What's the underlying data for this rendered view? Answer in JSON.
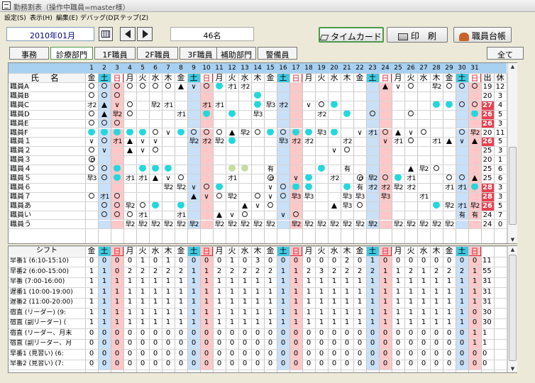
{
  "window": {
    "title": "勤務割表（操作中職員=master様）"
  },
  "menu": [
    "設定(S)",
    "表示(H)",
    "編集(E)",
    "デバッグ(D)",
    "ステップ(Z)"
  ],
  "toolbar": {
    "month": "2010年01月",
    "staff_count": "46名",
    "timecard_label": "タイムカード",
    "print_label": "印　刷",
    "staff_ledger_label": "職員台帳"
  },
  "departments": [
    "事務",
    "診療部門",
    "1F職員",
    "2F職員",
    "3F職員",
    "補助部門",
    "警備員"
  ],
  "selected_department": "診療部門",
  "all_label": "全て",
  "grid": {
    "name_header": "氏 名",
    "days": [
      "1",
      "2",
      "3",
      "4",
      "5",
      "6",
      "7",
      "8",
      "9",
      "10",
      "11",
      "12",
      "13",
      "14",
      "15",
      "16",
      "17",
      "18",
      "19",
      "20",
      "21",
      "22",
      "23",
      "24",
      "25",
      "26",
      "27",
      "28",
      "29",
      "30",
      "31"
    ],
    "weekdays": [
      "金",
      "土",
      "日",
      "月",
      "火",
      "水",
      "木",
      "金",
      "土",
      "日",
      "月",
      "火",
      "水",
      "木",
      "金",
      "土",
      "日",
      "月",
      "火",
      "水",
      "木",
      "金",
      "土",
      "日",
      "月",
      "火",
      "水",
      "木",
      "金",
      "土",
      "日"
    ],
    "total_headers": [
      "出",
      "休"
    ],
    "rows": [
      {
        "name": "職員A",
        "cells": [
          "o",
          "o",
          "o",
          "o",
          "o",
          "o",
          "o",
          "t",
          "v",
          "o",
          "C",
          "オ1",
          "オ2",
          "",
          "",
          "",
          "",
          "",
          "",
          "",
          "",
          "",
          "",
          "t",
          "v",
          "o",
          "",
          "早2",
          "o",
          "o",
          "o"
        ],
        "work": "19",
        "off": "12"
      },
      {
        "name": "職員B",
        "cells": [
          "o",
          "o",
          "o",
          "",
          "",
          "",
          "",
          "",
          "",
          "",
          "",
          "",
          "",
          "C",
          "",
          "",
          "",
          "",
          "",
          "",
          "",
          "",
          "",
          "",
          "",
          "",
          "",
          "",
          "",
          "",
          ""
        ],
        "work": "20",
        "off": "3"
      },
      {
        "name": "職員C",
        "cells": [
          "オ2",
          "t",
          "v",
          "o",
          "",
          "早2",
          "オ1",
          "",
          "",
          "オ1",
          "オ1",
          "",
          "",
          "C",
          "早3",
          "オ2",
          "",
          "v",
          "o",
          "C",
          "",
          "",
          "",
          "",
          "",
          "",
          "",
          "C",
          "C",
          "o",
          "o"
        ],
        "work": "27",
        "off": "4"
      },
      {
        "name": "職員D",
        "cells": [
          "o",
          "t",
          "早2",
          "o",
          "",
          "",
          "",
          "オ1",
          "",
          "C",
          "",
          "C",
          "",
          "早3",
          "",
          "",
          "",
          "",
          "オ2",
          "",
          "C",
          "",
          "o",
          "",
          "",
          "o",
          "",
          "",
          "",
          "",
          "C"
        ],
        "work": "26",
        "off": "5"
      },
      {
        "name": "職員E",
        "cells": [
          "o",
          "o",
          "o",
          "",
          "",
          "",
          "",
          "",
          "",
          "",
          "",
          "",
          "",
          "",
          "",
          "",
          "",
          "",
          "",
          "",
          "",
          "",
          "",
          "",
          "",
          "",
          "",
          "",
          "",
          "",
          ""
        ],
        "work": "26",
        "off": "3"
      },
      {
        "name": "職員F",
        "cells": [
          "C",
          "C",
          "C",
          "C",
          "C",
          "o",
          "v",
          "C",
          "o",
          "o",
          "o",
          "t",
          "早2",
          "o",
          "C",
          "o",
          "C",
          "C",
          "早3",
          "C",
          "",
          "v",
          "オ1",
          "o",
          "t",
          "v",
          "o",
          "",
          "",
          "o",
          "早2"
        ],
        "work": "20",
        "off": "11"
      },
      {
        "name": "職員１",
        "cells": [
          "v",
          "o",
          "オ1",
          "t",
          "v",
          "v",
          "",
          "",
          "早2",
          "オ2",
          "早2",
          "C",
          "",
          "",
          "",
          "早3",
          "オ2",
          "オ2",
          "",
          "",
          "オ2",
          "",
          "",
          "v",
          "オ1",
          "o",
          "",
          "オ1",
          "t",
          "v",
          "t"
        ],
        "work": "26",
        "off": "5"
      },
      {
        "name": "職員２",
        "cells": [
          "o",
          "v",
          "",
          "t",
          "v",
          "o",
          "",
          "",
          "",
          "",
          "",
          "",
          "",
          "",
          "",
          "",
          "",
          "",
          "",
          "v",
          "o",
          "",
          "",
          "",
          "",
          "",
          "",
          "",
          "",
          "",
          ""
        ],
        "work": "25",
        "off": "3"
      },
      {
        "name": "職員３",
        "cells": [
          "w",
          "",
          "",
          "",
          "",
          "",
          "",
          "",
          "",
          "",
          "",
          "",
          "",
          "",
          "",
          "",
          "",
          "",
          "",
          "",
          "",
          "",
          "",
          "",
          "",
          "",
          "",
          "",
          "",
          "",
          ""
        ],
        "work": "20",
        "off": "1"
      },
      {
        "name": "職員４",
        "cells": [
          "o",
          "o",
          "C",
          "",
          "C",
          "C",
          "C",
          "",
          "",
          "",
          "",
          "L",
          "L",
          "",
          "有",
          "",
          "",
          "",
          "C",
          "",
          "有",
          "",
          "",
          "",
          "",
          "t",
          "早2",
          "o",
          "",
          "",
          ""
        ],
        "work": "25",
        "off": "6"
      },
      {
        "name": "職員５",
        "cells": [
          "早3",
          "o",
          "C",
          "オ1",
          "オ1",
          "t",
          "v",
          "o",
          "",
          "",
          "",
          "オ1",
          "",
          "",
          "w",
          "",
          "v",
          "C",
          "",
          "オ2",
          "",
          "w",
          "早2",
          "o",
          "C",
          "オ1",
          "",
          "",
          "o",
          "o",
          "t"
        ],
        "work": "25",
        "off": "6"
      },
      {
        "name": "職員６",
        "cells": [
          "",
          "",
          "",
          "",
          "",
          "",
          "早2",
          "早2",
          "v",
          "o",
          "C",
          "",
          "",
          "",
          "v",
          "o",
          "C",
          "C",
          "",
          "",
          "C",
          "有",
          "オ2",
          "オ2",
          "早2",
          "オ2",
          "",
          "",
          "オ1",
          "オ1",
          "C"
        ],
        "work": "28",
        "off": "3"
      },
      {
        "name": "職員７",
        "cells": [
          "o",
          "オ1",
          "o",
          "",
          "",
          "",
          "",
          "",
          "t",
          "v",
          "o",
          "早2",
          "",
          "o",
          "v",
          "o",
          "早3",
          "早3",
          "",
          "",
          "早3",
          "早3",
          "",
          "早3",
          "",
          "",
          "オ1",
          "",
          "",
          "",
          ""
        ],
        "work": "28",
        "off": "3"
      },
      {
        "name": "職員あ",
        "cells": [
          "",
          "o",
          "o",
          "早2",
          "o",
          "C",
          "",
          "C",
          "",
          "",
          "",
          "",
          "t",
          "v",
          "o",
          "",
          "",
          "",
          "",
          "t",
          "早3",
          "o",
          "",
          "",
          "",
          "",
          "",
          "C",
          "早2",
          "オ1",
          "早2"
        ],
        "work": "26",
        "off": "5"
      },
      {
        "name": "職員い",
        "cells": [
          "",
          "o",
          "o",
          "o",
          "オ1",
          "",
          "",
          "オ1",
          "",
          "",
          "t",
          "v",
          "o",
          "",
          "",
          "v",
          "o",
          "",
          "",
          "",
          "",
          "",
          "",
          "",
          "",
          "",
          "",
          "",
          "",
          "有",
          "有"
        ],
        "work": "24",
        "off": "7"
      },
      {
        "name": "職員う",
        "cells": [
          "",
          "",
          "",
          "早2",
          "早2",
          "早2",
          "早2",
          "早2",
          "早2",
          "",
          "早2",
          "早2",
          "早2",
          "早2",
          "早2",
          "",
          "早2",
          "早2",
          "早2",
          "早2",
          "早2",
          "早2",
          "早2",
          "",
          "早2",
          "早2",
          "早2",
          "早2",
          "早2",
          "",
          ""
        ],
        "work": "24",
        "off": "0"
      }
    ]
  },
  "shift_table": {
    "header": "シフト",
    "rows": [
      {
        "name": "早番1 (6:10-15:10)",
        "values": [
          "0",
          "0",
          "0",
          "0",
          "1",
          "0",
          "1",
          "0",
          "0",
          "0",
          "0",
          "1",
          "0",
          "3",
          "0",
          "0",
          "0",
          "0",
          "0",
          "0",
          "2",
          "0",
          "1",
          "0",
          "0",
          "0",
          "0",
          "0",
          "0",
          "0",
          "0"
        ],
        "total": "11"
      },
      {
        "name": "早番2 (6:00-15:00)",
        "values": [
          "1",
          "1",
          "0",
          "2",
          "2",
          "2",
          "2",
          "2",
          "1",
          "1",
          "2",
          "2",
          "2",
          "2",
          "2",
          "1",
          "1",
          "2",
          "3",
          "2",
          "2",
          "2",
          "2",
          "1",
          "1",
          "2",
          "1",
          "2",
          "2",
          "2",
          "1"
        ],
        "total": "55"
      },
      {
        "name": "早番 (7:00-16:00)",
        "values": [
          "1",
          "1",
          "1",
          "1",
          "1",
          "1",
          "1",
          "1",
          "1",
          "1",
          "1",
          "1",
          "1",
          "1",
          "1",
          "1",
          "1",
          "1",
          "1",
          "1",
          "1",
          "1",
          "1",
          "1",
          "1",
          "1",
          "1",
          "1",
          "1",
          "1",
          "1"
        ],
        "total": "31"
      },
      {
        "name": "遅番1 (10:00-19:00)",
        "values": [
          "1",
          "1",
          "1",
          "1",
          "1",
          "1",
          "1",
          "1",
          "1",
          "1",
          "1",
          "1",
          "1",
          "1",
          "1",
          "1",
          "1",
          "1",
          "1",
          "1",
          "1",
          "1",
          "1",
          "1",
          "1",
          "1",
          "1",
          "1",
          "1",
          "1",
          "1"
        ],
        "total": "31"
      },
      {
        "name": "遅番2 (11:00-20:00)",
        "values": [
          "1",
          "1",
          "1",
          "1",
          "1",
          "1",
          "1",
          "1",
          "1",
          "1",
          "1",
          "1",
          "1",
          "1",
          "1",
          "1",
          "1",
          "1",
          "1",
          "1",
          "1",
          "1",
          "1",
          "1",
          "1",
          "1",
          "1",
          "1",
          "1",
          "1",
          "1"
        ],
        "total": "31"
      },
      {
        "name": "宿直 (リーダー) (9:",
        "values": [
          "1",
          "1",
          "1",
          "1",
          "1",
          "1",
          "1",
          "1",
          "1",
          "1",
          "1",
          "1",
          "1",
          "1",
          "1",
          "1",
          "1",
          "1",
          "1",
          "1",
          "1",
          "1",
          "1",
          "1",
          "1",
          "1",
          "1",
          "1",
          "1",
          "1",
          "0"
        ],
        "total": "30"
      },
      {
        "name": "宿直 (副リーダー) (",
        "values": [
          "1",
          "1",
          "1",
          "1",
          "1",
          "1",
          "1",
          "1",
          "1",
          "1",
          "1",
          "1",
          "1",
          "1",
          "1",
          "1",
          "1",
          "1",
          "1",
          "1",
          "1",
          "1",
          "1",
          "1",
          "1",
          "1",
          "1",
          "1",
          "1",
          "1",
          "0"
        ],
        "total": "30"
      },
      {
        "name": "宿直 (リーダー、月末",
        "values": [
          "0",
          "0",
          "0",
          "0",
          "0",
          "0",
          "0",
          "0",
          "0",
          "0",
          "0",
          "0",
          "0",
          "0",
          "0",
          "0",
          "0",
          "0",
          "0",
          "0",
          "0",
          "0",
          "0",
          "0",
          "0",
          "0",
          "0",
          "0",
          "0",
          "0",
          "1"
        ],
        "total": "1"
      },
      {
        "name": "宿直 (副リーダー、月",
        "values": [
          "0",
          "0",
          "0",
          "0",
          "0",
          "0",
          "0",
          "0",
          "0",
          "0",
          "0",
          "0",
          "0",
          "0",
          "0",
          "0",
          "0",
          "0",
          "0",
          "0",
          "0",
          "0",
          "0",
          "0",
          "0",
          "0",
          "0",
          "0",
          "0",
          "0",
          "1"
        ],
        "total": "1"
      },
      {
        "name": "早番1 (見習い) (6:",
        "values": [
          "0",
          "0",
          "0",
          "0",
          "0",
          "0",
          "0",
          "0",
          "0",
          "0",
          "0",
          "0",
          "0",
          "0",
          "0",
          "0",
          "0",
          "0",
          "0",
          "0",
          "0",
          "0",
          "0",
          "0",
          "0",
          "0",
          "0",
          "0",
          "0",
          "0",
          "0"
        ],
        "total": "0"
      },
      {
        "name": "早番2 (見習い) (7:",
        "values": [
          "0",
          "0",
          "0",
          "0",
          "0",
          "0",
          "0",
          "0",
          "0",
          "0",
          "0",
          "0",
          "0",
          "0",
          "0",
          "0",
          "0",
          "0",
          "0",
          "0",
          "0",
          "0",
          "0",
          "0",
          "0",
          "0",
          "0",
          "0",
          "0",
          "0",
          "0"
        ],
        "total": "0"
      }
    ]
  },
  "colors": {
    "cyan": "#22d8dc",
    "light_green": "#c8dca0",
    "sat_bg": "#c8e0f8",
    "sun_bg": "#ffc8c8",
    "header_blue": "#a8d0f0",
    "warn_red": "#e84050"
  },
  "icons": {
    "calendar": "calendar-icon",
    "prev": "chevron-left-icon",
    "next": "chevron-right-icon",
    "timecard": "timecard-icon",
    "print": "printer-icon",
    "ledger": "staff-ledger-icon"
  }
}
